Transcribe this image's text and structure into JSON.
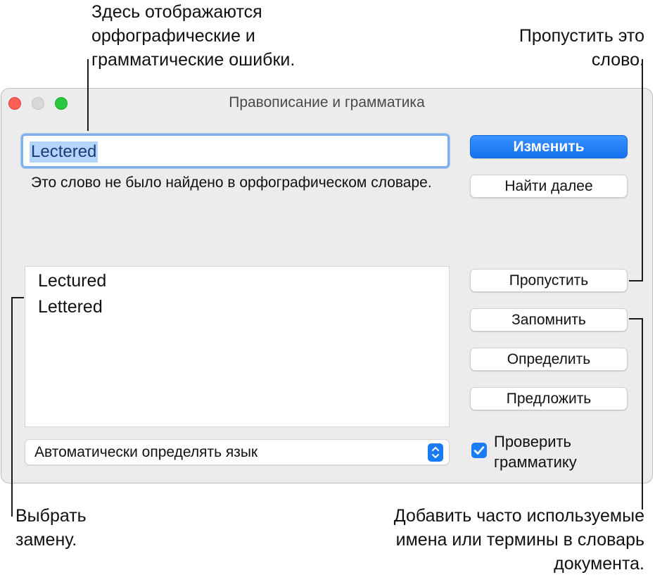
{
  "callouts": {
    "top_left": [
      "Здесь отображаются",
      "орфографические и",
      "грамматические ошибки."
    ],
    "top_right": [
      "Пропустить это",
      "слово."
    ],
    "bottom_left": [
      "Выбрать",
      "замену."
    ],
    "bottom_right": [
      "Добавить часто используемые",
      "имена или термины в словарь",
      "документа."
    ]
  },
  "window": {
    "title": "Правописание и грамматика",
    "word_field_value": "Lectered",
    "message": "Это слово не было найдено в орфографическом словаре.",
    "suggestions": [
      "Lectured",
      "Lettered"
    ],
    "language_select": "Автоматически определять язык",
    "buttons": {
      "change": "Изменить",
      "find_next": "Найти далее",
      "ignore": "Пропустить",
      "learn": "Запомнить",
      "define": "Определить",
      "guess": "Предложить"
    },
    "check_grammar": {
      "checked": true,
      "label_lines": [
        "Проверить",
        "грамматику"
      ]
    }
  },
  "colors": {
    "accent": "#1a7cf5",
    "close": "#ff5f57",
    "minimize_disabled": "#d8d8d8",
    "zoom": "#28c840",
    "selection": "#b3d4fc"
  }
}
